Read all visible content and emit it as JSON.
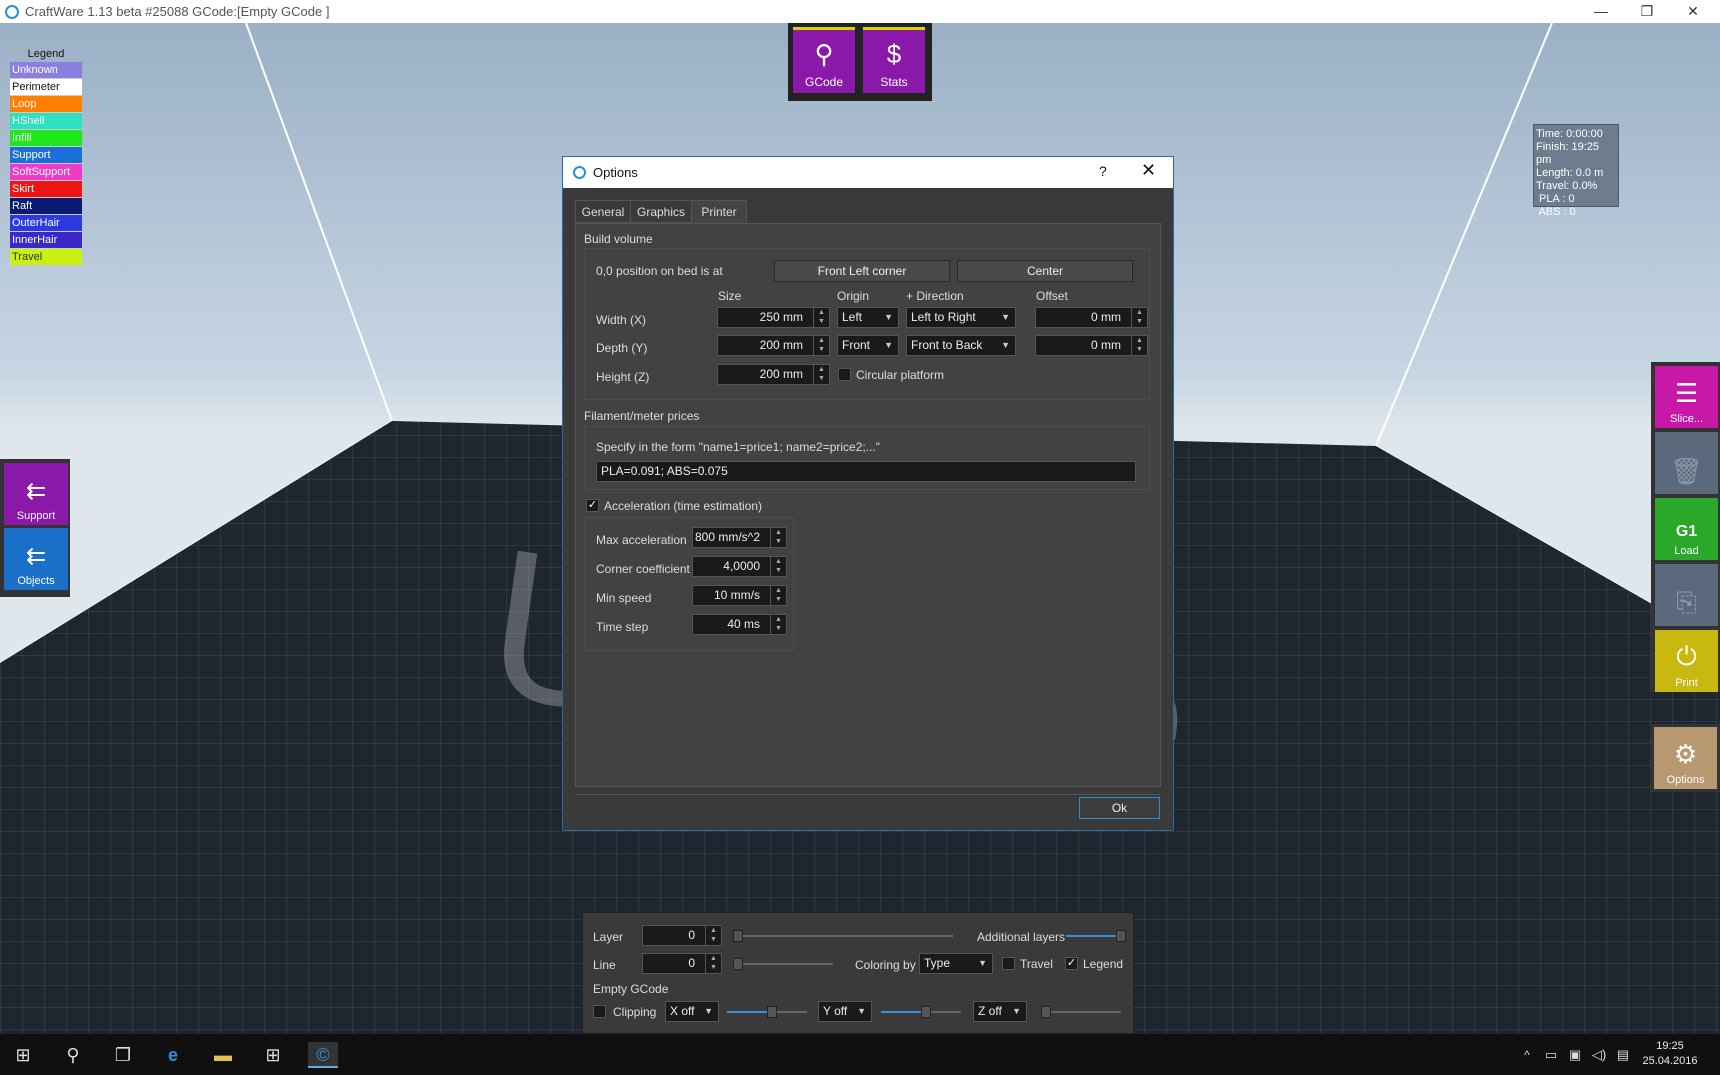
{
  "window": {
    "title": "CraftWare 1.13 beta #25088   GCode:[Empty GCode ]",
    "minimize": "—",
    "maximize": "❐",
    "close": "✕"
  },
  "watermark": "Unique",
  "legend": {
    "title": "Legend",
    "items": [
      {
        "label": "Unknown",
        "color": "#8a7fe0"
      },
      {
        "label": "Perimeter",
        "color": "#ffffff"
      },
      {
        "label": "Loop",
        "color": "#ff7f00"
      },
      {
        "label": "HShell",
        "color": "#2fe0c0"
      },
      {
        "label": "Infill",
        "color": "#1fe81f"
      },
      {
        "label": "Support",
        "color": "#1a6fd8"
      },
      {
        "label": "SoftSupport",
        "color": "#f03ac8"
      },
      {
        "label": "Skirt",
        "color": "#f01515"
      },
      {
        "label": "Raft",
        "color": "#0a1a70"
      },
      {
        "label": "OuterHair",
        "color": "#2a3ae0"
      },
      {
        "label": "InnerHair",
        "color": "#3a28c8"
      },
      {
        "label": "Travel",
        "color": "#c8f010"
      }
    ]
  },
  "top_buttons": [
    {
      "label": "GCode",
      "icon": "g1-magnifier-icon"
    },
    {
      "label": "Stats",
      "icon": "dollar-magnifier-icon"
    }
  ],
  "stats": [
    "Time: 0:00:00",
    "Finish: 19:25 pm",
    "Length: 0.0 m",
    "Travel: 0.0%",
    " PLA : 0",
    " ABS : 0"
  ],
  "left_buttons": [
    {
      "label": "Support",
      "color": "#8a18a8"
    },
    {
      "label": "Objects",
      "color": "#1a6fc8"
    }
  ],
  "right_buttons": [
    {
      "label": "Slice...",
      "color": "#c818a8"
    },
    {
      "label": "",
      "color": "#5a6a7c"
    },
    {
      "label": "Load",
      "color": "#2aa82a"
    },
    {
      "label": "",
      "color": "#5a6a7c"
    },
    {
      "label": "Print",
      "color": "#c8b810"
    }
  ],
  "options_button": {
    "label": "Options",
    "color": "#b89870"
  },
  "dialog": {
    "title": "Options",
    "help": "?",
    "close": "✕",
    "tabs": [
      "General",
      "Graphics",
      "Printer"
    ],
    "build_volume": {
      "title": "Build volume",
      "position_label": "0,0 position on bed is at",
      "btn_front_left": "Front Left corner",
      "btn_center": "Center",
      "headers": {
        "size": "Size",
        "origin": "Origin",
        "direction": "+ Direction",
        "offset": "Offset"
      },
      "rows": [
        {
          "label": "Width (X)",
          "size": "250 mm",
          "origin": "Left",
          "direction": "Left to Right",
          "offset": "0 mm"
        },
        {
          "label": "Depth (Y)",
          "size": "200 mm",
          "origin": "Front",
          "direction": "Front to Back",
          "offset": "0 mm"
        },
        {
          "label": "Height (Z)",
          "size": "200 mm"
        }
      ],
      "circular_platform": "Circular platform"
    },
    "filament": {
      "title": "Filament/meter prices",
      "hint": "Specify in the form \"name1=price1; name2=price2;...\"",
      "value": "PLA=0.091; ABS=0.075"
    },
    "acceleration": {
      "title": "Acceleration (time estimation)",
      "checked": true,
      "rows": [
        {
          "label": "Max acceleration",
          "value": "800 mm/s^2"
        },
        {
          "label": "Corner coefficient",
          "value": "4,0000"
        },
        {
          "label": "Min speed",
          "value": "10 mm/s"
        },
        {
          "label": "Time step",
          "value": "40 ms"
        }
      ]
    },
    "ok": "Ok"
  },
  "bottom_bar": {
    "layer_label": "Layer",
    "layer_value": "0",
    "additional_layers": "Additional layers",
    "line_label": "Line",
    "line_value": "0",
    "coloring_by": "Coloring by",
    "coloring_value": "Type",
    "travel": "Travel",
    "legend": "Legend",
    "status": "Empty GCode",
    "clipping": "Clipping",
    "x_off": "X off",
    "y_off": "Y off",
    "z_off": "Z off"
  },
  "taskbar": {
    "time": "19:25",
    "date": "25.04.2016"
  }
}
